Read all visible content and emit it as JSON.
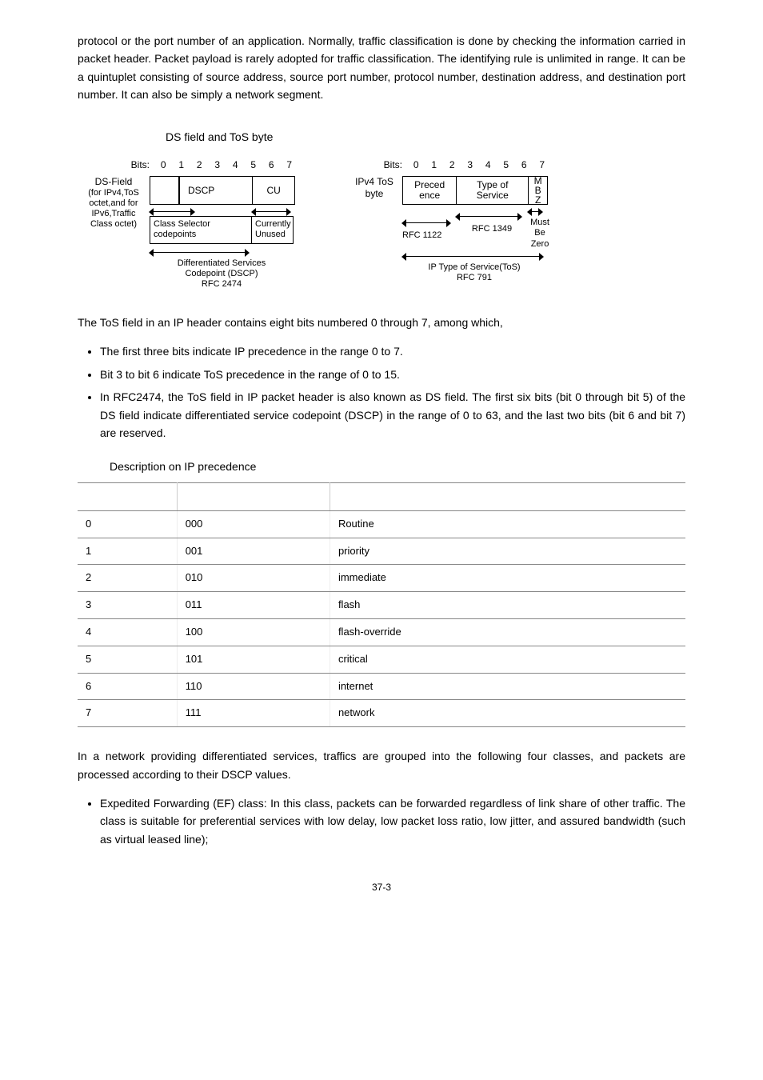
{
  "intro_para": "protocol or the port number of an application. Normally, traffic classification is done by checking the information carried in packet header. Packet payload is rarely adopted for traffic classification. The identifying rule is unlimited in range. It can be a quintuplet consisting of source address, source port number, protocol number, destination address, and destination port number. It can also be simply a network segment.",
  "figure_title": "DS field and ToS byte",
  "left": {
    "bits_prefix": "Bits:",
    "bits": [
      "0",
      "1",
      "2",
      "3",
      "4",
      "5",
      "6",
      "7"
    ],
    "side_label_1": "DS-Field",
    "side_label_2": "(for IPv4,ToS",
    "side_label_3": "octet,and for",
    "side_label_4": "IPv6,Traffic",
    "side_label_5": "Class octet)",
    "dscp": "DSCP",
    "cu": "CU",
    "class_sel_1": "Class Selector",
    "class_sel_2": "codepoints",
    "curr_1": "Currently",
    "curr_2": "Unused",
    "bottom_1": "Differentiated Services",
    "bottom_2": "Codepoint (DSCP)",
    "bottom_3": "RFC 2474"
  },
  "right": {
    "bits_prefix": "Bits:",
    "bits": [
      "0",
      "1",
      "2",
      "3",
      "4",
      "5",
      "6",
      "7"
    ],
    "side_label_1": "IPv4 ToS",
    "side_label_2": "byte",
    "preced_1": "Preced",
    "preced_2": "ence",
    "typesvc_1": "Type of",
    "typesvc_2": "Service",
    "mbz_m": "M",
    "mbz_b": "B",
    "mbz_z": "Z",
    "rfc1122": "RFC 1122",
    "rfc1349": "RFC 1349",
    "must": "Must",
    "be": "Be",
    "zero": "Zero",
    "bottom_1": "IP Type of Service(ToS)",
    "bottom_2": "RFC 791"
  },
  "after_fig_para": "The ToS field in an IP header contains eight bits numbered 0 through 7, among which,",
  "bullets": [
    "The first three bits indicate IP precedence in the range 0 to 7.",
    "Bit 3 to bit 6 indicate ToS precedence in the range of 0 to 15.",
    "In RFC2474, the ToS field in IP packet header is also known as DS field. The first six bits (bit 0 through bit 5) of the DS field indicate differentiated service codepoint (DSCP) in the range of 0 to 63, and the last two bits (bit 6 and bit 7) are reserved."
  ],
  "table_caption": "Description on IP precedence",
  "chart_data": {
    "type": "table",
    "columns": [
      "",
      "",
      ""
    ],
    "rows": [
      [
        "0",
        "000",
        "Routine"
      ],
      [
        "1",
        "001",
        "priority"
      ],
      [
        "2",
        "010",
        "immediate"
      ],
      [
        "3",
        "011",
        "flash"
      ],
      [
        "4",
        "100",
        "flash-override"
      ],
      [
        "5",
        "101",
        "critical"
      ],
      [
        "6",
        "110",
        "internet"
      ],
      [
        "7",
        "111",
        "network"
      ]
    ]
  },
  "post_para": "In a network providing differentiated services, traffics are grouped into the following four classes, and packets are processed according to their DSCP values.",
  "post_bullets": [
    "Expedited Forwarding (EF) class: In this class, packets can be forwarded regardless of link share of other traffic. The class is suitable for preferential services with low delay, low packet loss ratio, low jitter, and assured bandwidth (such as virtual leased line);"
  ],
  "page_number": "37-3"
}
